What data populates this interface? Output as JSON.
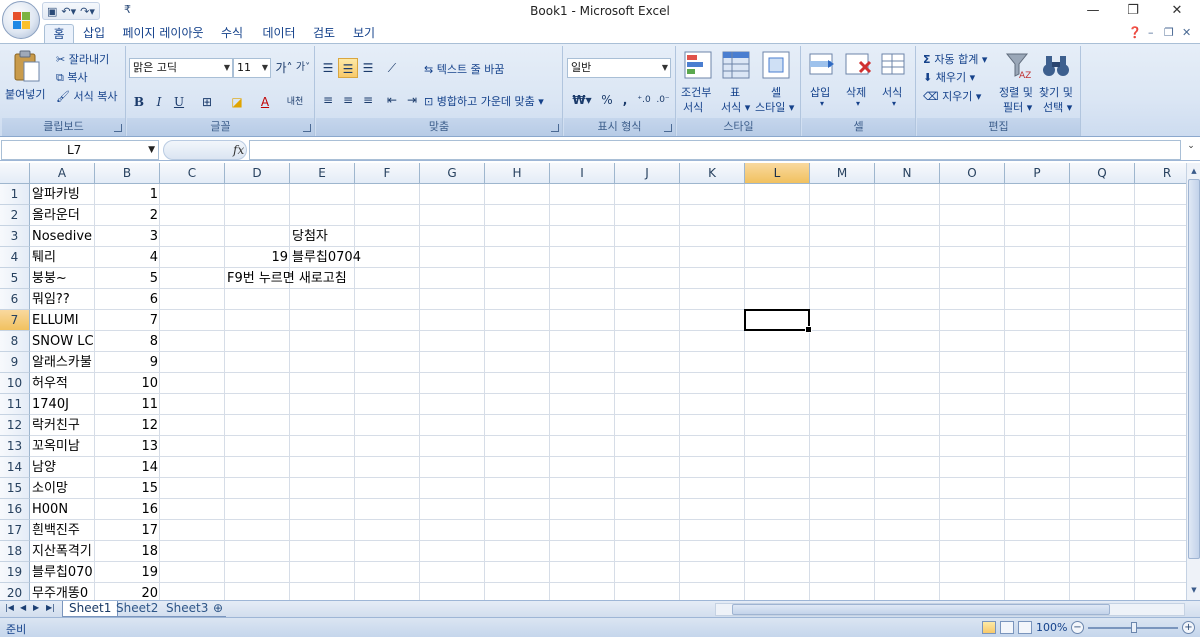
{
  "window": {
    "title": "Book1 - Microsoft Excel"
  },
  "tabs": [
    "홈",
    "삽입",
    "페이지 레이아웃",
    "수식",
    "데이터",
    "검토",
    "보기"
  ],
  "ribbon": {
    "clipboard": {
      "paste": "붙여넣기",
      "cut": "잘라내기",
      "copy": "복사",
      "format_painter": "서식 복사",
      "label": "클립보드"
    },
    "font": {
      "name": "맑은 고딕",
      "size": "11",
      "label": "글꼴"
    },
    "alignment": {
      "wrap_text": "텍스트 줄 바꿈",
      "merge_center": "병합하고 가운데 맞춤",
      "label": "맞춤"
    },
    "number": {
      "format": "일반",
      "label": "표시 형식"
    },
    "styles": {
      "conditional_1": "조건부",
      "conditional_2": "서식",
      "table_1": "표",
      "table_2": "서식",
      "cell_1": "셀",
      "cell_2": "스타일",
      "label": "스타일"
    },
    "cells": {
      "insert": "삽입",
      "delete": "삭제",
      "format": "서식",
      "label": "셀"
    },
    "editing": {
      "autosum": "자동 합계",
      "fill": "채우기",
      "clear": "지우기",
      "sort_1": "정렬 및",
      "sort_2": "필터",
      "find_1": "찾기 및",
      "find_2": "선택",
      "label": "편집"
    }
  },
  "formula_bar": {
    "name_box": "L7",
    "fx": "fx",
    "value": ""
  },
  "grid": {
    "columns": [
      "A",
      "B",
      "C",
      "D",
      "E",
      "F",
      "G",
      "H",
      "I",
      "J",
      "K",
      "L",
      "M",
      "N",
      "O",
      "P",
      "Q",
      "R"
    ],
    "rows": [
      "1",
      "2",
      "3",
      "4",
      "5",
      "6",
      "7",
      "8",
      "9",
      "10",
      "11",
      "12",
      "13",
      "14",
      "15",
      "16",
      "17",
      "18",
      "19",
      "20"
    ],
    "col_a": [
      "알파카빙",
      "올라운더",
      "Nosedive",
      "퉤리",
      "붕붕~",
      "뭐임??",
      "ELLUMI",
      "SNOW LC",
      "알래스카불",
      "허우적",
      "1740J",
      "락커친구",
      "꼬옥미남",
      "남양",
      "소이망",
      "H00N",
      "흰백진주",
      "지산폭격기",
      "블루칩070",
      "무주개똥0"
    ],
    "col_b": [
      "1",
      "2",
      "3",
      "4",
      "5",
      "6",
      "7",
      "8",
      "9",
      "10",
      "11",
      "12",
      "13",
      "14",
      "15",
      "16",
      "17",
      "18",
      "19",
      "20"
    ],
    "e3": "당첨자",
    "d4": "19",
    "e4": "블루칩0704",
    "d5": "F9번 누르면 새로고침"
  },
  "sheets": [
    "Sheet1",
    "Sheet2",
    "Sheet3"
  ],
  "status": {
    "ready": "준비",
    "zoom": "100%"
  }
}
